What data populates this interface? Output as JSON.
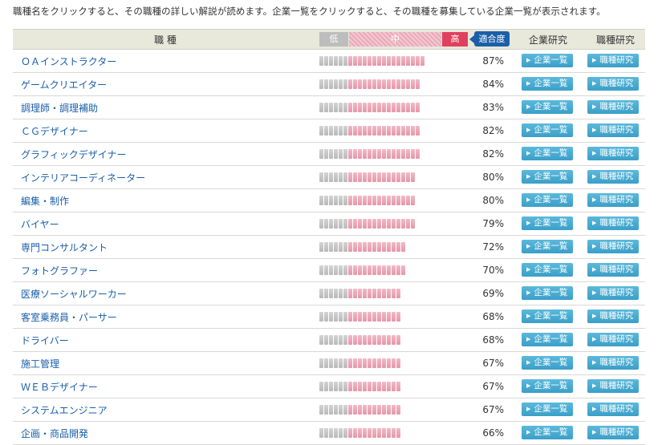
{
  "intro": "職種名をクリックすると、その職種の詳しい解説が読めます。企業一覧をクリックすると、その職種を募集している企業一覧が表示されます。",
  "header": {
    "job": "職 種",
    "low": "低",
    "mid": "中",
    "high": "高",
    "match": "適合度",
    "company": "企業研究",
    "jobres": "職種研究"
  },
  "buttons": {
    "company": "企業一覧",
    "jobres": "職種研究"
  },
  "rows": [
    {
      "name": "ＯＡインストラクター",
      "pct": "87%",
      "level": 0.87
    },
    {
      "name": "ゲームクリエイター",
      "pct": "84%",
      "level": 0.84
    },
    {
      "name": "調理師・調理補助",
      "pct": "83%",
      "level": 0.83
    },
    {
      "name": "ＣＧデザイナー",
      "pct": "82%",
      "level": 0.82
    },
    {
      "name": "グラフィックデザイナー",
      "pct": "82%",
      "level": 0.82
    },
    {
      "name": "インテリアコーディネーター",
      "pct": "80%",
      "level": 0.8
    },
    {
      "name": "編集・制作",
      "pct": "80%",
      "level": 0.8
    },
    {
      "name": "バイヤー",
      "pct": "79%",
      "level": 0.79
    },
    {
      "name": "専門コンサルタント",
      "pct": "72%",
      "level": 0.72
    },
    {
      "name": "フォトグラファー",
      "pct": "70%",
      "level": 0.7
    },
    {
      "name": "医療ソーシャルワーカー",
      "pct": "69%",
      "level": 0.69
    },
    {
      "name": "客室乗務員・パーサー",
      "pct": "68%",
      "level": 0.68
    },
    {
      "name": "ドライバー",
      "pct": "68%",
      "level": 0.68
    },
    {
      "name": "施工管理",
      "pct": "67%",
      "level": 0.67
    },
    {
      "name": "ＷＥＢデザイナー",
      "pct": "67%",
      "level": 0.67
    },
    {
      "name": "システムエンジニア",
      "pct": "67%",
      "level": 0.67
    },
    {
      "name": "企画・商品開発",
      "pct": "66%",
      "level": 0.66
    }
  ]
}
